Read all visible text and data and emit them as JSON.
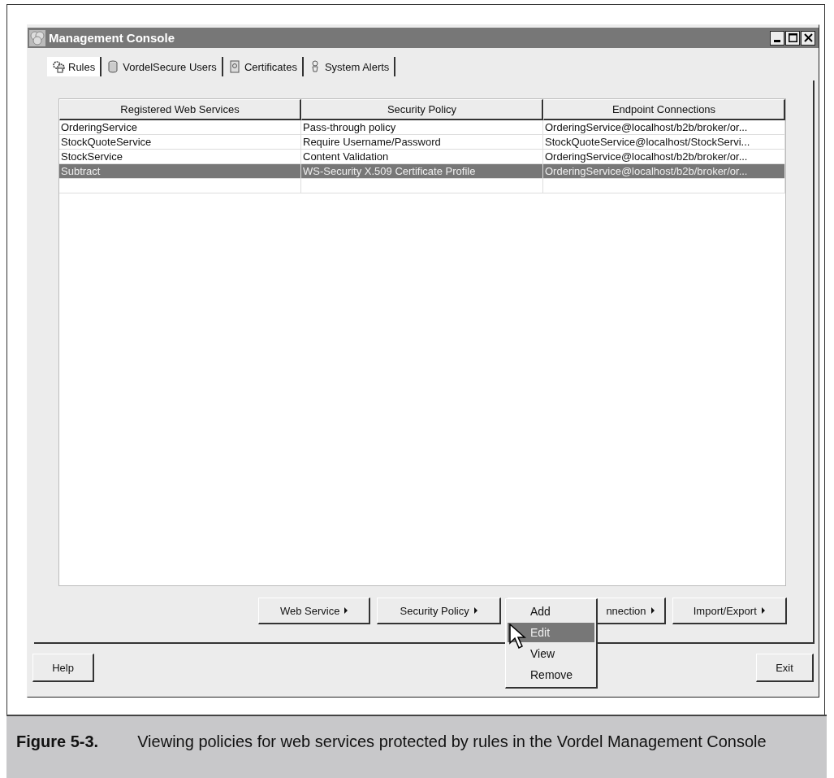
{
  "window": {
    "title": "Management Console"
  },
  "tabs": [
    {
      "label": "Rules",
      "selected": true
    },
    {
      "label": "VordelSecure Users",
      "selected": false
    },
    {
      "label": "Certificates",
      "selected": false
    },
    {
      "label": "System Alerts",
      "selected": false
    }
  ],
  "table": {
    "columns": [
      "Registered Web Services",
      "Security Policy",
      "Endpoint Connections"
    ],
    "rows": [
      {
        "cells": [
          "OrderingService",
          "Pass-through policy",
          "OrderingService@localhost/b2b/broker/or..."
        ],
        "selected": false
      },
      {
        "cells": [
          "StockQuoteService",
          "Require Username/Password",
          "StockQuoteService@localhost/StockServi..."
        ],
        "selected": false
      },
      {
        "cells": [
          "StockService",
          "Content Validation",
          "OrderingService@localhost/b2b/broker/or..."
        ],
        "selected": false
      },
      {
        "cells": [
          "Subtract",
          "WS-Security X.509 Certificate Profile",
          "OrderingService@localhost/b2b/broker/or..."
        ],
        "selected": true
      }
    ]
  },
  "action_buttons": [
    {
      "label": "Web Service",
      "kind": "full"
    },
    {
      "label": "Security Policy",
      "kind": "full"
    },
    {
      "label": "nnection",
      "kind": "covered"
    },
    {
      "label": "Import/Export",
      "kind": "full"
    }
  ],
  "popup_menu": {
    "items": [
      {
        "label": "Add",
        "selected": false
      },
      {
        "label": "Edit",
        "selected": true
      },
      {
        "label": "View",
        "selected": false
      },
      {
        "label": "Remove",
        "selected": false
      }
    ]
  },
  "bottom_buttons": [
    "Help",
    "Exit"
  ],
  "caption": {
    "number": "Figure 5-3.",
    "text": "Viewing policies for web services protected by rules in the Vordel Management Console"
  }
}
